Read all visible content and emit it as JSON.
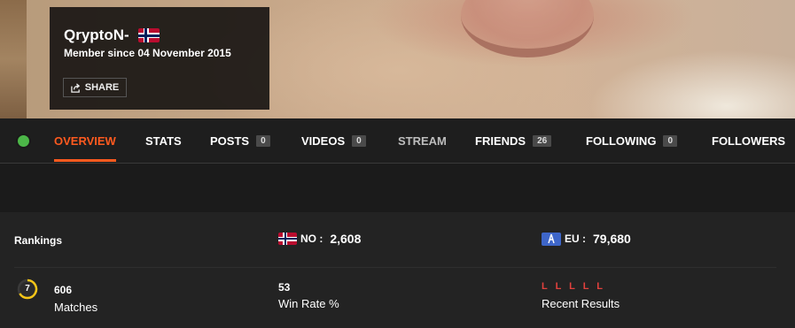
{
  "profile": {
    "username": "QryptoN-",
    "flag_icon": "norway-flag-icon",
    "member_since": "Member since 04 November 2015",
    "share_label": "SHARE",
    "share_icon": "share-icon",
    "online": true
  },
  "nav": {
    "items": [
      {
        "label": "OVERVIEW",
        "active": true
      },
      {
        "label": "STATS"
      },
      {
        "label": "POSTS",
        "badge": "0"
      },
      {
        "label": "VIDEOS",
        "badge": "0"
      },
      {
        "label": "STREAM"
      },
      {
        "label": "FRIENDS",
        "badge": "26"
      },
      {
        "label": "FOLLOWING",
        "badge": "0"
      },
      {
        "label": "FOLLOWERS"
      }
    ]
  },
  "rankings": {
    "label": "Rankings",
    "country": {
      "code": "NO :",
      "value": "2,608"
    },
    "region": {
      "code": "EU :",
      "value": "79,680"
    }
  },
  "stats": {
    "level": "7",
    "matches_value": "606",
    "matches_label": "Matches",
    "winrate_value": "53",
    "winrate_label": "Win Rate %",
    "recent_results": "L L L L L",
    "recent_label": "Recent Results"
  },
  "colors": {
    "accent": "#ff5a1f",
    "online": "#4cb648",
    "loss": "#e2413d",
    "level_ring": "#f5c518"
  }
}
